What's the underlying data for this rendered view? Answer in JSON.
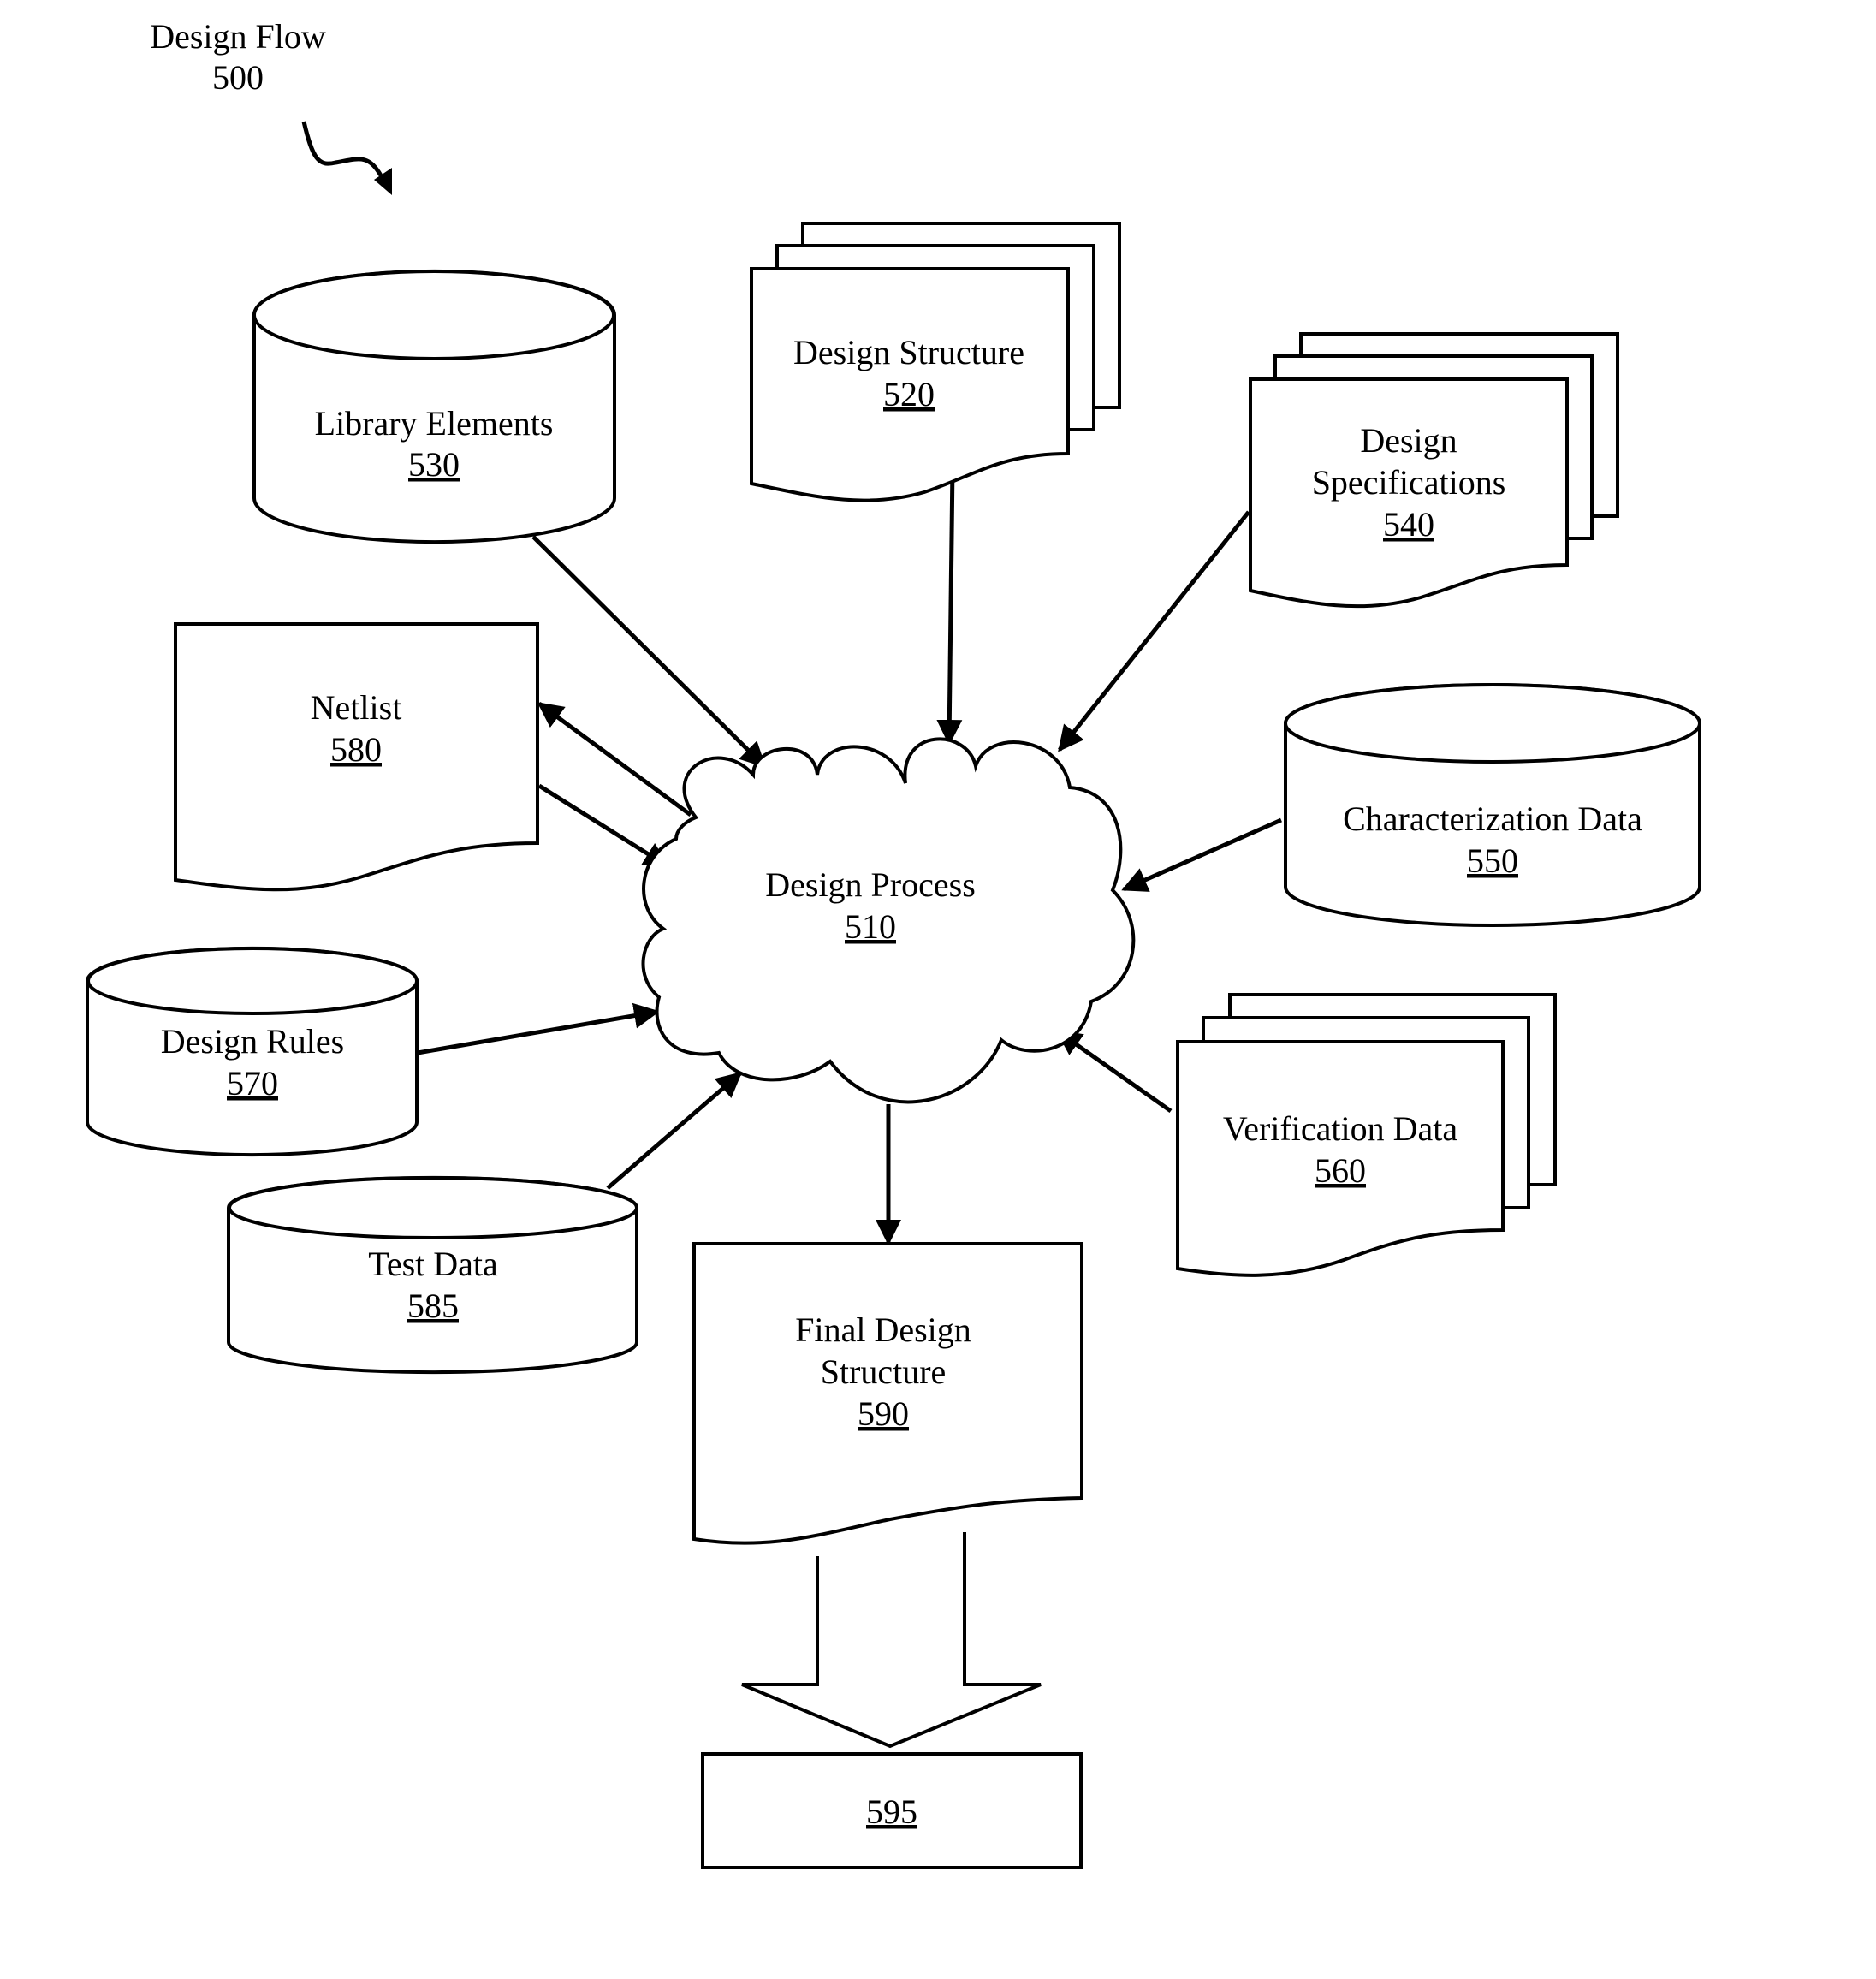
{
  "figure": {
    "title": "Design Flow",
    "title_ref": "500"
  },
  "nodes": {
    "design_process": {
      "label": "Design Process",
      "ref": "510",
      "shape": "cloud"
    },
    "design_structure": {
      "label": "Design Structure",
      "ref": "520",
      "shape": "multi-document"
    },
    "library_elements": {
      "label": "Library Elements",
      "ref": "530",
      "shape": "cylinder"
    },
    "design_specifications": {
      "label_line1": "Design",
      "label_line2": "Specifications",
      "ref": "540",
      "shape": "multi-document"
    },
    "characterization_data": {
      "label": "Characterization Data",
      "ref": "550",
      "shape": "cylinder"
    },
    "verification_data": {
      "label": "Verification Data",
      "ref": "560",
      "shape": "multi-document"
    },
    "design_rules": {
      "label": "Design Rules",
      "ref": "570",
      "shape": "cylinder"
    },
    "netlist": {
      "label": "Netlist",
      "ref": "580",
      "shape": "document"
    },
    "test_data": {
      "label": "Test Data",
      "ref": "585",
      "shape": "cylinder"
    },
    "final_design_structure": {
      "label_line1": "Final Design",
      "label_line2": "Structure",
      "ref": "590",
      "shape": "document"
    },
    "output_595": {
      "label": "",
      "ref": "595",
      "shape": "rectangle"
    }
  },
  "edges": [
    {
      "from": "530",
      "to": "510"
    },
    {
      "from": "520",
      "to": "510"
    },
    {
      "from": "540",
      "to": "510"
    },
    {
      "from": "550",
      "to": "510"
    },
    {
      "from": "560",
      "to": "510"
    },
    {
      "from": "510",
      "to": "580"
    },
    {
      "from": "580",
      "to": "510"
    },
    {
      "from": "570",
      "to": "510"
    },
    {
      "from": "585",
      "to": "510"
    },
    {
      "from": "510",
      "to": "590"
    },
    {
      "from": "590",
      "to": "595",
      "style": "block-arrow"
    }
  ]
}
